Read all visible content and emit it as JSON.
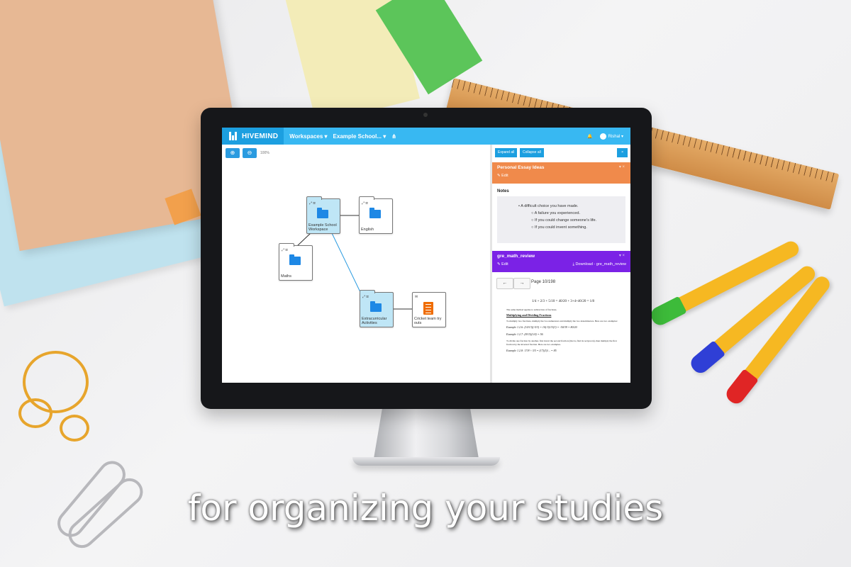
{
  "app": {
    "brand": "HIVEMIND",
    "brand_color": "#1c9fe0",
    "nav_color": "#38b8f2"
  },
  "nav": {
    "workspaces": "Workspaces ▾",
    "current": "Example School... ▾",
    "user": "Rishal",
    "bell_icon": "bell-icon",
    "tree_icon": "sitemap-icon"
  },
  "canvas": {
    "zoom_in_icon": "zoom-in-icon",
    "zoom_out_icon": "zoom-out-icon",
    "zoom_level": "100%",
    "nodes": [
      {
        "label": "Example School\nWorkspace",
        "type": "folder",
        "selected": true
      },
      {
        "label": "English",
        "type": "folder",
        "selected": false
      },
      {
        "label": "Maths",
        "type": "folder",
        "selected": false
      },
      {
        "label": "Extracurricular\nActivities",
        "type": "folder",
        "selected": true
      },
      {
        "label": "Cricket team try\nouts",
        "type": "document",
        "selected": false
      }
    ]
  },
  "panel": {
    "expand_all": "Expand all",
    "collapse_all": "Collapse all",
    "close": "×",
    "cards": [
      {
        "title": "Personal Essay Ideas",
        "edit": "Edit",
        "color": "#f08a4b"
      },
      {
        "title": "gre_math_review",
        "edit": "Edit",
        "download": "Download - gre_math_review",
        "color": "#7b22e6"
      }
    ],
    "notes": {
      "label": "Notes",
      "items": [
        "A difficult choice you have made.",
        "A failure you experienced.",
        "If you could change someone's life.",
        "If you could invent something."
      ]
    },
    "pdf": {
      "page": "Page 10/198",
      "eq1": "1/4 + 2/3 + 5/10 = 40/20 + 3+4+40/20 = 1/8",
      "p1": "The same method applies to subtraction of fractions.",
      "heading": "Multiplying and Dividing Fractions",
      "p2": "To multiply two fractions, multiply the two numerators and multiply the two denominators. Here are two examples:",
      "ex1": "Example 1.2.6: (10/13)(-5/3) = 10(-5)/13(3) = -50/39 = 80/20",
      "ex2": "Example 1.2.7: (8/15)(1/4) = 56",
      "p3": "To divide one fraction by another, first invert the second fraction (that is, find its reciprocal), then multiply the first fraction by the inverted fraction. Here are two examples.",
      "ex3": "Example 1.2.8: 17/8 ÷ 3/5 = (17)(5)/... = 85"
    }
  },
  "tagline": "for organizing your studies"
}
